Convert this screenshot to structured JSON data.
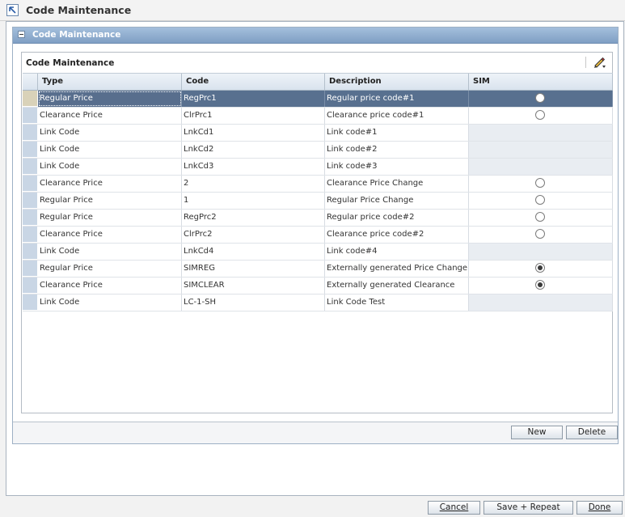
{
  "window": {
    "title": "Code Maintenance"
  },
  "section": {
    "title": "Code Maintenance"
  },
  "panel": {
    "title": "Code Maintenance"
  },
  "table": {
    "headers": {
      "type": "Type",
      "code": "Code",
      "description": "Description",
      "sim": "SIM"
    },
    "rows": [
      {
        "type": "Regular Price",
        "code": "RegPrc1",
        "description": "Regular price code#1",
        "sim": "off",
        "selected": true
      },
      {
        "type": "Clearance Price",
        "code": "ClrPrc1",
        "description": "Clearance price code#1",
        "sim": "off"
      },
      {
        "type": "Link Code",
        "code": "LnkCd1",
        "description": "Link code#1",
        "sim": "none"
      },
      {
        "type": "Link Code",
        "code": "LnkCd2",
        "description": "Link code#2",
        "sim": "none"
      },
      {
        "type": "Link Code",
        "code": "LnkCd3",
        "description": "Link code#3",
        "sim": "none"
      },
      {
        "type": "Clearance Price",
        "code": "2",
        "description": "Clearance Price Change",
        "sim": "off"
      },
      {
        "type": "Regular Price",
        "code": "1",
        "description": "Regular Price Change",
        "sim": "off"
      },
      {
        "type": "Regular Price",
        "code": "RegPrc2",
        "description": "Regular price code#2",
        "sim": "off"
      },
      {
        "type": "Clearance Price",
        "code": "ClrPrc2",
        "description": "Clearance price code#2",
        "sim": "off"
      },
      {
        "type": "Link Code",
        "code": "LnkCd4",
        "description": "Link code#4",
        "sim": "none"
      },
      {
        "type": "Regular Price",
        "code": "SIMREG",
        "description": "Externally generated Price Change",
        "sim": "on"
      },
      {
        "type": "Clearance Price",
        "code": "SIMCLEAR",
        "description": "Externally generated Clearance",
        "sim": "on"
      },
      {
        "type": "Link Code",
        "code": "LC-1-SH",
        "description": "Link Code Test",
        "sim": "none"
      }
    ]
  },
  "buttons": {
    "new": "New",
    "delete": "Delete",
    "cancel": "Cancel",
    "save_repeat": "Save + Repeat",
    "done": "Done"
  }
}
